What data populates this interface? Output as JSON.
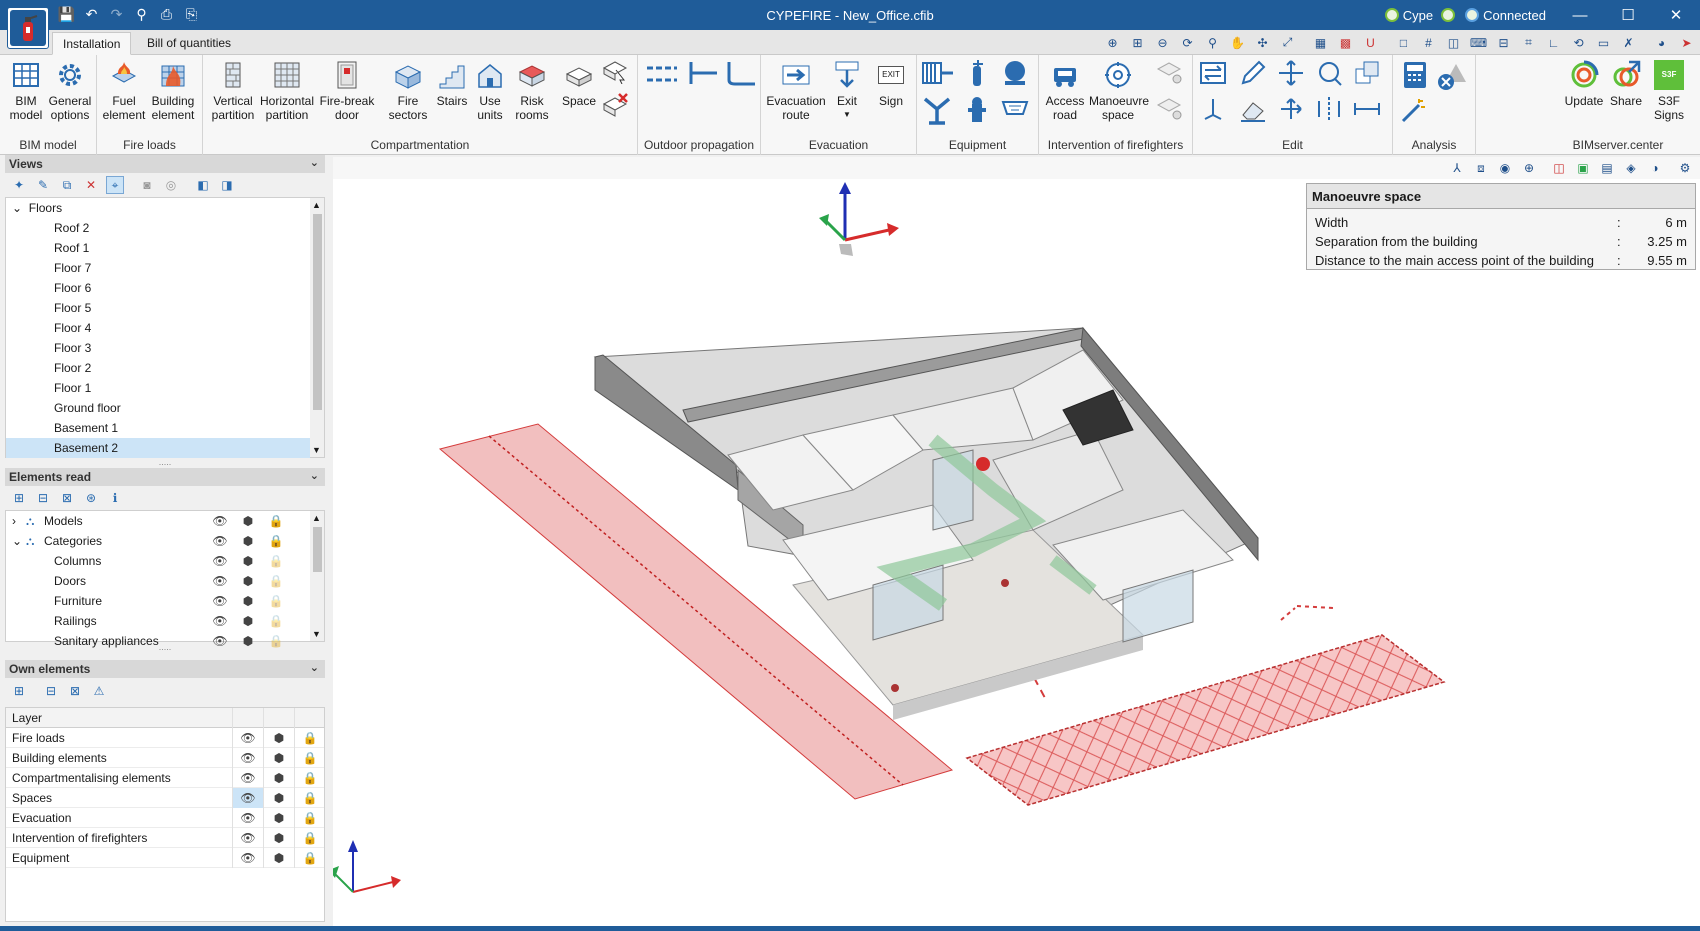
{
  "window": {
    "title": "CYPEFIRE - New_Office.cfib",
    "user": "Cype",
    "status": "Connected",
    "minimize": "—",
    "maximize": "☐",
    "close": "✕"
  },
  "tabs": [
    {
      "label": "Installation",
      "active": true
    },
    {
      "label": "Bill of quantities",
      "active": false
    }
  ],
  "ribbon": {
    "groups": {
      "bim_model": "BIM model",
      "fire_loads": "Fire loads",
      "compartmentation": "Compartmentation",
      "outdoor": "Outdoor propagation",
      "evacuation": "Evacuation",
      "equipment": "Equipment",
      "intervention": "Intervention of firefighters",
      "edit": "Edit",
      "analysis": "Analysis",
      "bimserver": "BIMserver.center"
    },
    "buttons": {
      "bim_model": [
        "BIM",
        "model"
      ],
      "general_options": [
        "General",
        "options"
      ],
      "fuel_element": [
        "Fuel",
        "element"
      ],
      "building_element": [
        "Building",
        "element"
      ],
      "vertical_partition": [
        "Vertical",
        "partition"
      ],
      "horizontal_partition": [
        "Horizontal",
        "partition"
      ],
      "fire_break_door": [
        "Fire-break",
        "door"
      ],
      "fire_sectors": [
        "Fire",
        "sectors"
      ],
      "stairs": "Stairs",
      "use_units": [
        "Use",
        "units"
      ],
      "risk_rooms": [
        "Risk",
        "rooms"
      ],
      "space": "Space",
      "evacuation_route": [
        "Evacuation",
        "route"
      ],
      "exit": "Exit",
      "sign": "Sign",
      "exit_sign_text": "EXIT",
      "access_road": [
        "Access",
        "road"
      ],
      "manoeuvre_space": [
        "Manoeuvre",
        "space"
      ],
      "update": "Update",
      "share": "Share",
      "s3f_signs": [
        "S3F",
        "Signs"
      ],
      "s3f_text": "S3F"
    }
  },
  "views_panel": {
    "title": "Views",
    "root": "Floors",
    "items": [
      "Roof 2",
      "Roof 1",
      "Floor 7",
      "Floor 6",
      "Floor 5",
      "Floor 4",
      "Floor 3",
      "Floor 2",
      "Floor 1",
      "Ground floor",
      "Basement 1",
      "Basement 2"
    ],
    "selected": "Basement 2"
  },
  "elements_panel": {
    "title": "Elements read",
    "rows": [
      {
        "label": "Models",
        "level": 0,
        "expander": "›"
      },
      {
        "label": "Categories",
        "level": 0,
        "expander": "⌄"
      },
      {
        "label": "Columns",
        "level": 1
      },
      {
        "label": "Doors",
        "level": 1
      },
      {
        "label": "Furniture",
        "level": 1
      },
      {
        "label": "Railings",
        "level": 1
      },
      {
        "label": "Sanitary appliances",
        "level": 1
      }
    ]
  },
  "own_panel": {
    "title": "Own elements",
    "header": "Layer",
    "layers": [
      "Fire loads",
      "Building elements",
      "Compartmentalising elements",
      "Spaces",
      "Evacuation",
      "Intervention of firefighters",
      "Equipment"
    ],
    "highlighted": "Spaces"
  },
  "info_box": {
    "title": "Manoeuvre space",
    "rows": [
      {
        "label": "Width",
        "value": "6 m"
      },
      {
        "label": "Separation from the building",
        "value": "3.25 m"
      },
      {
        "label": "Distance to the main access point of the building",
        "value": "9.55 m"
      }
    ]
  },
  "colors": {
    "title_bar": "#1f5c99",
    "selection": "#cce4f7",
    "zone_fill": "#f0b4b4",
    "zone_stroke": "#d43c3c",
    "accent_green": "#5fbf3a"
  }
}
